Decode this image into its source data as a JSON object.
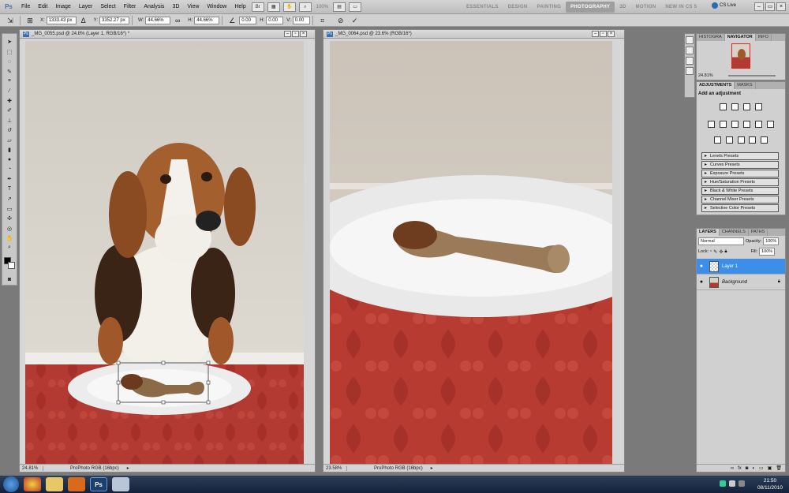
{
  "menubar": {
    "logo": "Ps",
    "items": [
      "File",
      "Edit",
      "Image",
      "Layer",
      "Select",
      "Filter",
      "Analysis",
      "3D",
      "View",
      "Window",
      "Help"
    ],
    "zoom": "100%",
    "workspaces": [
      "ESSENTIALS",
      "DESIGN",
      "PAINTING",
      "PHOTOGRAPHY",
      "3D",
      "MOTION",
      "NEW IN CS 5"
    ],
    "active_workspace": "PHOTOGRAPHY",
    "cslive": "CS Live"
  },
  "options": {
    "x_label": "X:",
    "x_value": "1333.43 px",
    "y_label": "Y:",
    "y_value": "3352.27 px",
    "w_label": "W:",
    "w_value": "44.66%",
    "h_label": "H:",
    "h_value": "44.66%",
    "angle_value": "0.00",
    "hskew_label": "H:",
    "hskew_value": "0.00",
    "vskew_label": "V:",
    "vskew_value": "0.00"
  },
  "doc1": {
    "title": "_MG_0055.psd @ 24.8% (Layer 1, RGB/16*) *",
    "zoom": "24.81%",
    "profile": "ProPhoto RGB (16bpc)"
  },
  "doc2": {
    "title": "_MG_0064.psd @ 23.6% (RGB/16*)",
    "zoom": "23.58%",
    "profile": "ProPhoto RGB (16bpc)"
  },
  "navigator": {
    "tabs": [
      "HISTOGRA",
      "NAVIGATOR",
      "INFO"
    ],
    "active_tab": "NAVIGATOR",
    "zoom": "24.81%"
  },
  "adjustments": {
    "tabs": [
      "ADJUSTMENTS",
      "MASKS"
    ],
    "active_tab": "ADJUSTMENTS",
    "heading": "Add an adjustment",
    "presets": [
      "Levels Presets",
      "Curves Presets",
      "Exposure Presets",
      "Hue/Saturation Presets",
      "Black & White Presets",
      "Channel Mixer Presets",
      "Selective Color Presets"
    ]
  },
  "layers": {
    "tabs": [
      "LAYERS",
      "CHANNELS",
      "PATHS"
    ],
    "active_tab": "LAYERS",
    "blend_mode": "Normal",
    "opacity_label": "Opacity:",
    "opacity": "100%",
    "lock_label": "Lock:",
    "fill_label": "Fill:",
    "fill": "100%",
    "rows": [
      {
        "name": "Layer 1",
        "selected": true
      },
      {
        "name": "Background",
        "selected": false
      }
    ]
  },
  "taskbar": {
    "time": "21:50",
    "date": "08/11/2010",
    "ps_label": "Ps"
  },
  "colors": {
    "accent_blue": "#3c8ee8",
    "tablecloth": "#b23a32",
    "wall": "#d8d4cc"
  }
}
